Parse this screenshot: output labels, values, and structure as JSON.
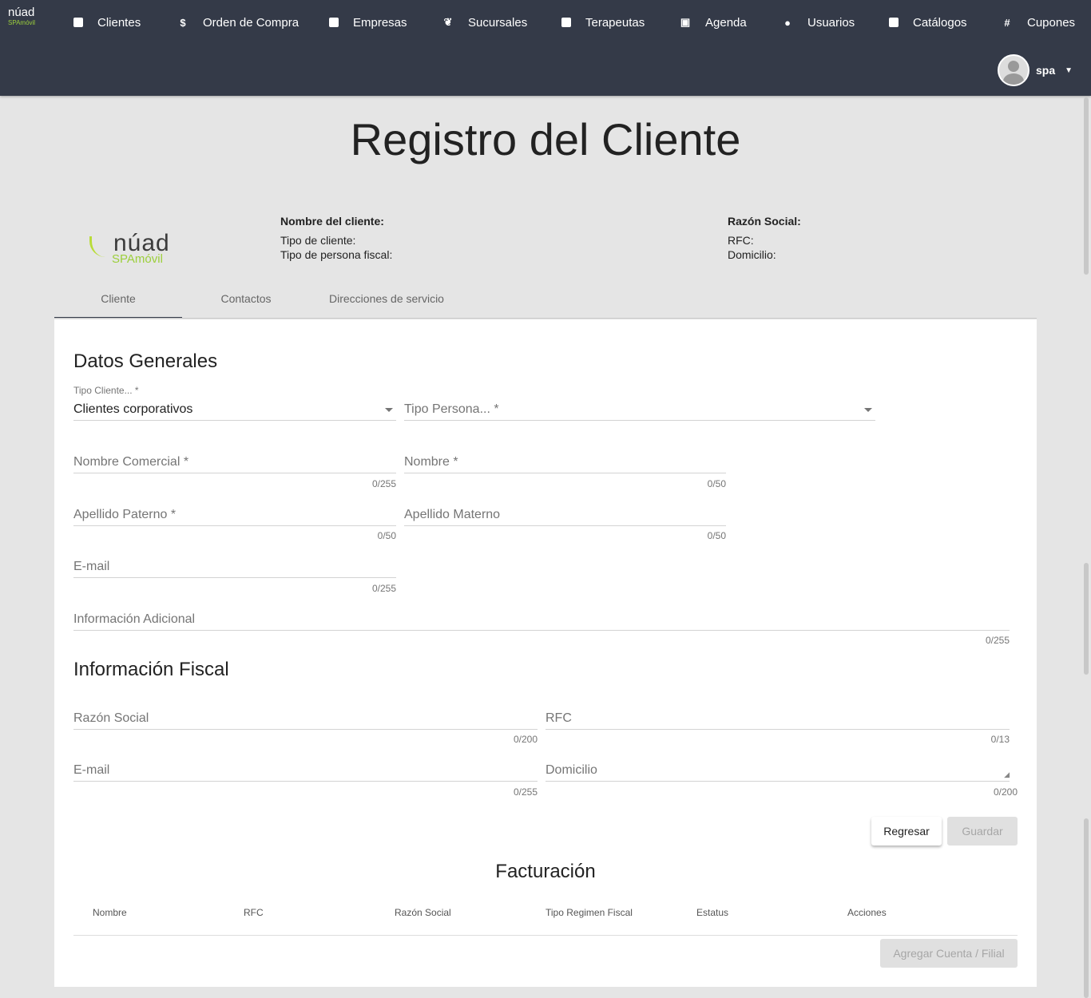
{
  "header": {
    "logo": "núad",
    "logo_sub": "SPAmóvil",
    "nav": [
      {
        "label": "Clientes",
        "icon": "contact-card-icon"
      },
      {
        "label": "Orden de Compra",
        "icon": "dollar-icon"
      },
      {
        "label": "Empresas",
        "icon": "briefcase-icon"
      },
      {
        "label": "Sucursales",
        "icon": "spa-icon"
      },
      {
        "label": "Terapeutas",
        "icon": "contact-card-icon"
      },
      {
        "label": "Agenda",
        "icon": "calendar-icon"
      },
      {
        "label": "Usuarios",
        "icon": "person-icon"
      },
      {
        "label": "Catálogos",
        "icon": "image-icon"
      },
      {
        "label": "Cupones",
        "icon": "hash-icon"
      }
    ],
    "user": "spa"
  },
  "page_title": "Registro del Cliente",
  "summary": {
    "name_label": "Nombre del cliente:",
    "tipo_cliente": "Tipo de cliente:",
    "tipo_persona": "Tipo de persona fiscal:",
    "razon_label": "Razón Social:",
    "rfc": "RFC:",
    "domicilio": "Domicilio:"
  },
  "tabs": [
    "Cliente",
    "Contactos",
    "Direcciones de servicio"
  ],
  "general": {
    "title": "Datos Generales",
    "tipo_cliente_label": "Tipo Cliente... *",
    "tipo_cliente_value": "Clientes corporativos",
    "tipo_persona": "Tipo Persona... *",
    "nombre_comercial": "Nombre Comercial *",
    "nombre_comercial_count": "0/255",
    "nombre": "Nombre *",
    "nombre_count": "0/50",
    "ap_paterno": "Apellido Paterno *",
    "ap_paterno_count": "0/50",
    "ap_materno": "Apellido Materno",
    "ap_materno_count": "0/50",
    "email": "E-mail",
    "email_count": "0/255",
    "info": "Información Adicional",
    "info_count": "0/255"
  },
  "fiscal": {
    "title": "Información Fiscal",
    "razon": "Razón Social",
    "razon_count": "0/200",
    "rfc": "RFC",
    "rfc_count": "0/13",
    "email": "E-mail",
    "email_count": "0/255",
    "domicilio": "Domicilio",
    "domicilio_count": "0/200"
  },
  "buttons": {
    "back": "Regresar",
    "save": "Guardar",
    "add": "Agregar Cuenta / Filial"
  },
  "billing": {
    "title": "Facturación",
    "columns": [
      "Nombre",
      "RFC",
      "Razón Social",
      "Tipo Regimen Fiscal",
      "Estatus",
      "Acciones"
    ]
  }
}
